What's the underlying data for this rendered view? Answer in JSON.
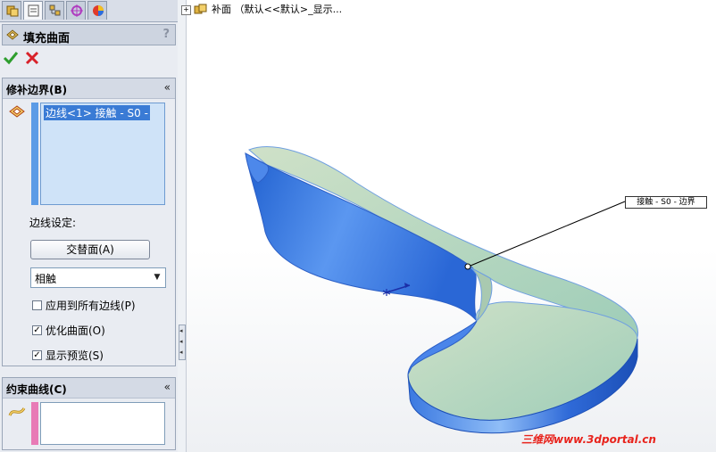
{
  "tree": {
    "label": "补面 （默认<<默认>_显示..."
  },
  "panel": {
    "title": "填充曲面",
    "help": "?",
    "ok": "✔",
    "cancel": "✖",
    "patch_boundary": {
      "title": "修补边界(B)",
      "collapse": "«",
      "items": [
        "边线<1> 接触 - S0 -"
      ],
      "edge_settings_label": "边线设定:",
      "alternate_face_button": "交替面(A)",
      "condition_select": "相触",
      "apply_all_edges": {
        "label": "应用到所有边线(P)",
        "checked": false
      },
      "optimize_surface": {
        "label": "优化曲面(O)",
        "checked": true
      },
      "show_preview": {
        "label": "显示预览(S)",
        "checked": true
      }
    },
    "constraint_curves": {
      "title": "约束曲线(C)",
      "collapse": "«"
    }
  },
  "viewport": {
    "callout": "接触 - S0 - 边界"
  },
  "watermark": "三维网www.3dportal.cn",
  "colors": {
    "surface_blue": "#3f7fe3",
    "surface_green": "#b9d6b6",
    "selection_blue": "#3a7bd5",
    "constraint_pink": "#e87ab6",
    "ok_green": "#2e9e2e",
    "cancel_red": "#d8222a"
  }
}
